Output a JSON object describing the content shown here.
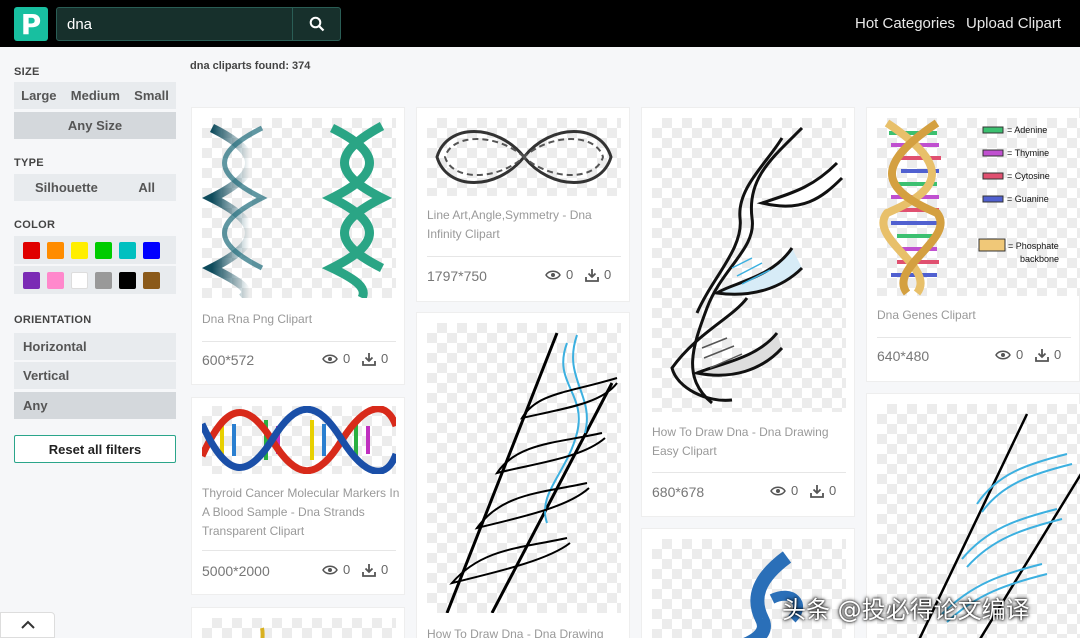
{
  "header": {
    "logo_letter": "P",
    "search_value": "dna",
    "nav": [
      "Hot Categories",
      "Upload Clipart"
    ]
  },
  "sidebar": {
    "size_title": "SIZE",
    "size_options": [
      "Large",
      "Medium",
      "Small"
    ],
    "size_selected": "Any Size",
    "type_title": "TYPE",
    "type_options": [
      "Silhouette",
      "All"
    ],
    "color_title": "COLOR",
    "colors": [
      "#e00000",
      "#ff8c00",
      "#ffee00",
      "#00cc00",
      "#00c0c0",
      "#0000ff",
      "#7b2bb5",
      "#ff88cc",
      "#ffffff",
      "#999999",
      "#000000",
      "#8b5a1a"
    ],
    "orientation_title": "ORIENTATION",
    "orientation_options": [
      "Horizontal",
      "Vertical",
      "Any"
    ],
    "reset_label": "Reset all filters"
  },
  "results_label": "dna cliparts found: 374",
  "cards": [
    {
      "title": "Dna Rna Png Clipart",
      "dims": "600*572",
      "views": "0",
      "downloads": "0"
    },
    {
      "title": "Thyroid Cancer Molecular Markers In A Blood Sample - Dna Strands Transparent Clipart",
      "dims": "5000*2000",
      "views": "0",
      "downloads": "0"
    },
    {
      "title": "Line Art,Angle,Symmetry - Dna Infinity Clipart",
      "dims": "1797*750",
      "views": "0",
      "downloads": "0"
    },
    {
      "title": "How To Draw Dna - Dna Drawing",
      "dims": "",
      "views": "",
      "downloads": ""
    },
    {
      "title": "How To Draw Dna - Dna Drawing Easy Clipart",
      "dims": "680*678",
      "views": "0",
      "downloads": "0"
    },
    {
      "title": "Dna Genes Clipart",
      "dims": "640*480",
      "views": "0",
      "downloads": "0"
    }
  ],
  "genes_legend": [
    "= Adenine",
    "= Thymine",
    "= Cytosine",
    "= Guanine",
    "= Phosphate",
    "backbone"
  ],
  "watermark": "头条 @投必得论文编译"
}
